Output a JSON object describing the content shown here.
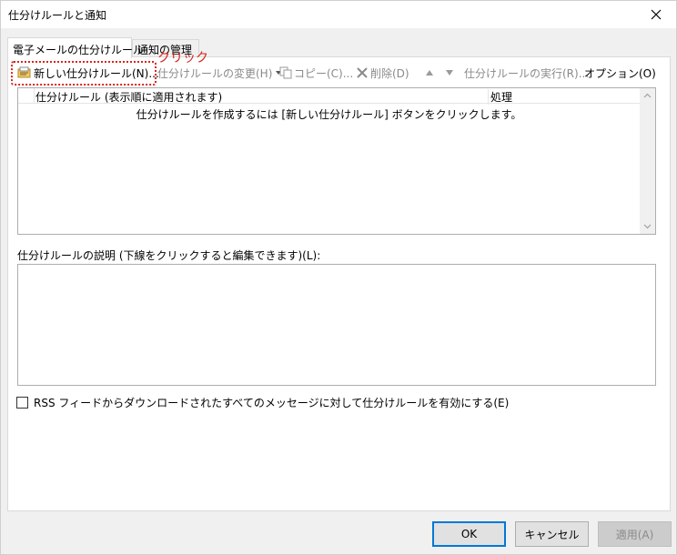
{
  "window": {
    "title": "仕分けルールと通知"
  },
  "tabs": [
    {
      "label": "電子メールの仕分けルール",
      "active": true
    },
    {
      "label": "通知の管理",
      "active": false
    }
  ],
  "toolbar": {
    "new_rule": "新しい仕分けルール(N)...",
    "change_rule": "仕分けルールの変更(H)",
    "copy": "コピー(C)...",
    "delete": "削除(D)",
    "run_rules": "仕分けルールの実行(R)...",
    "options": "オプション(O)"
  },
  "annotation": {
    "label": "クリック",
    "color": "#d9251d"
  },
  "rules_list": {
    "columns": [
      "仕分けルール (表示順に適用されます)",
      "処理"
    ],
    "empty_message": "仕分けルールを作成するには [新しい仕分けルール] ボタンをクリックします。"
  },
  "description": {
    "label": "仕分けルールの説明 (下線をクリックすると編集できます)(L):"
  },
  "rss_option": {
    "label": "RSS フィードからダウンロードされたすべてのメッセージに対して仕分けルールを有効にする(E)",
    "checked": false
  },
  "buttons": {
    "ok": "OK",
    "cancel": "キャンセル",
    "apply": "適用(A)"
  }
}
